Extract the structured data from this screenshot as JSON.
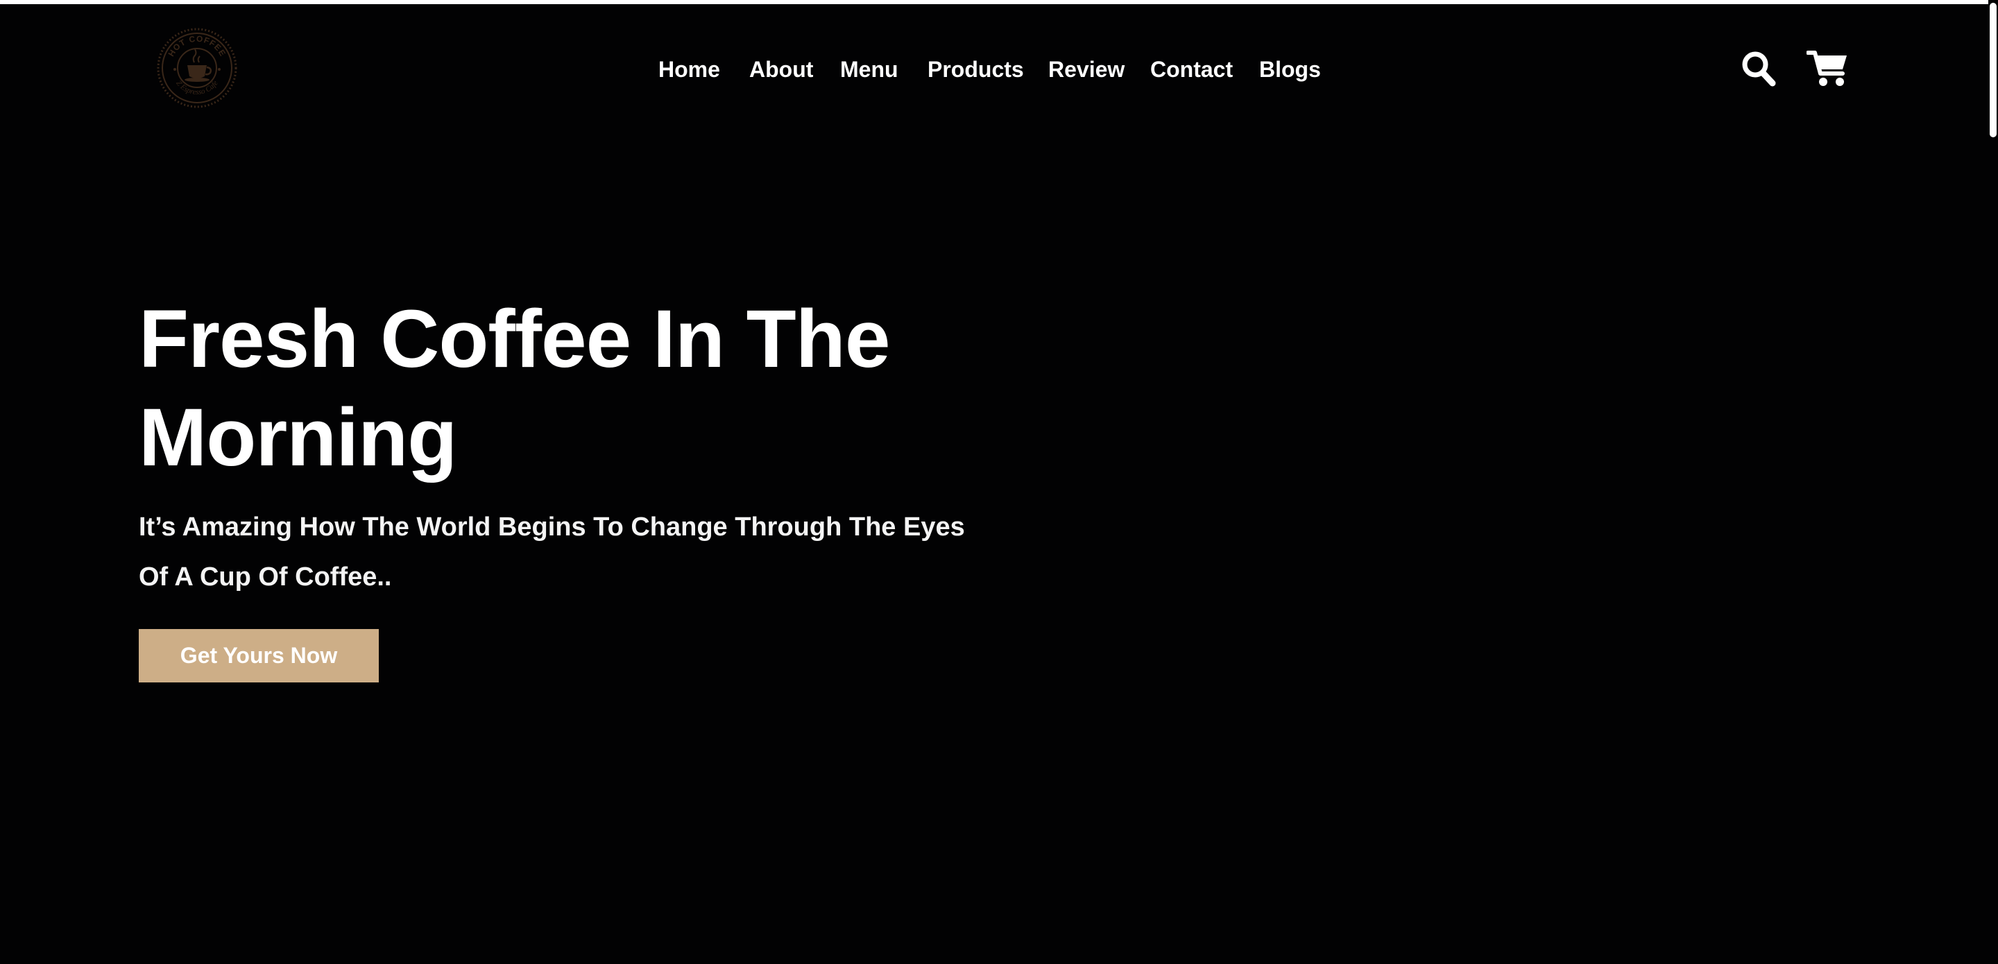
{
  "logo": {
    "top_text": "HOT COFFEE",
    "bottom_text": "Z Espresso Cafe",
    "color": "#3a2719",
    "icon": "coffee-cup-icon"
  },
  "nav": {
    "items": [
      {
        "label": "Home"
      },
      {
        "label": "About"
      },
      {
        "label": "Menu"
      },
      {
        "label": "Products"
      },
      {
        "label": "Review"
      },
      {
        "label": "Contact"
      },
      {
        "label": "Blogs"
      }
    ]
  },
  "header_actions": {
    "search_icon": "search-icon",
    "cart_icon": "cart-icon"
  },
  "hero": {
    "title_line1": "Fresh Coffee In The",
    "title_line2": "Morning",
    "subtitle_line1": "It’s Amazing How The World Begins To Change Through The Eyes",
    "subtitle_line2": "Of A Cup Of Coffee..",
    "cta_label": "Get Yours Now"
  },
  "colors": {
    "background": "#020203",
    "accent": "#cdae87",
    "text": "#ffffff"
  }
}
